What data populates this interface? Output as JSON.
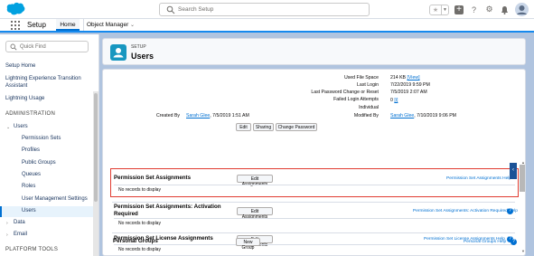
{
  "header": {
    "search_placeholder": "Search Setup"
  },
  "context": {
    "app_name": "Setup",
    "tabs": [
      "Home",
      "Object Manager"
    ]
  },
  "sidebar": {
    "quick_find_placeholder": "Quick Find",
    "items": [
      "Setup Home",
      "Lightning Experience Transition Assistant",
      "Lightning Usage"
    ],
    "sections": [
      "ADMINISTRATION",
      "PLATFORM TOOLS"
    ],
    "users_group": "Users",
    "users_children": [
      "Permission Sets",
      "Profiles",
      "Public Groups",
      "Queues",
      "Roles",
      "User Management Settings",
      "Users"
    ],
    "data": "Data",
    "email": "Email"
  },
  "page_header": {
    "eyebrow": "SETUP",
    "title": "Users"
  },
  "details": {
    "used_file_space_label": "Used File Space",
    "used_file_space_value": "214 KB",
    "used_file_space_link": "[View]",
    "last_login_label": "Last Login",
    "last_login_value": "7/22/2019 9:59 PM",
    "last_password_label": "Last Password Change or Reset",
    "last_password_value": "7/5/2019 2:07 AM",
    "failed_login_label": "Failed Login Attempts",
    "failed_login_value": "0",
    "failed_login_link": "[i]",
    "individual_label": "Individual",
    "created_by_label": "Created By",
    "created_by_name": "Sarah Glee",
    "created_by_date": ", 7/5/2019 1:51 AM",
    "modified_by_label": "Modified By",
    "modified_by_name": "Sarah Glee",
    "modified_by_date": ", 7/10/2019 9:06 PM",
    "buttons": [
      "Edit",
      "Sharing",
      "Change Password"
    ]
  },
  "related_lists": [
    {
      "title": "Permission Set Assignments",
      "button": "Edit Assignments",
      "help": "Permission Set Assignments Help",
      "body": "No records to display"
    },
    {
      "title_line1": "Permission Set Assignments: Activation",
      "title_line2": "Required",
      "button": "Edit Assignments",
      "help": "Permission Set Assignments: Activation Required Help",
      "body": "No records to display"
    },
    {
      "title": "Permission Set License Assignments",
      "button": "Edit Assignments",
      "help": "Permission Set License Assignments Help",
      "body": "No records to display"
    },
    {
      "title": "Personal Groups",
      "button": "New Group",
      "help": "Personal Groups Help"
    }
  ],
  "help_glyph": "?"
}
